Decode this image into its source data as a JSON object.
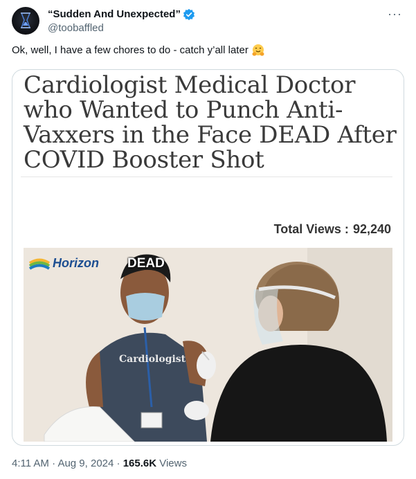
{
  "author": {
    "display_name": "“Sudden And Unexpected”",
    "handle": "@toobaffled"
  },
  "tweet": {
    "text": "Ok, well, I have a few chores to do - catch y’all later"
  },
  "card": {
    "headline": "Cardiologist Medical Doctor who Wanted to Punch Anti-Vaxxers in the Face DEAD After COVID Booster Shot",
    "views_label": "Total Views :",
    "views_value": "92,240",
    "image_label": "DEAD",
    "logo_text": "Horizon",
    "shirt_text": "Cardiologist"
  },
  "meta": {
    "time": "4:11 AM",
    "sep1": " · ",
    "date": "Aug 9, 2024",
    "sep2": " · ",
    "views_count": "165.6K",
    "views_word": " Views"
  },
  "colors": {
    "verified": "#1d9bf0",
    "muted": "#536471",
    "text": "#0f1419"
  }
}
